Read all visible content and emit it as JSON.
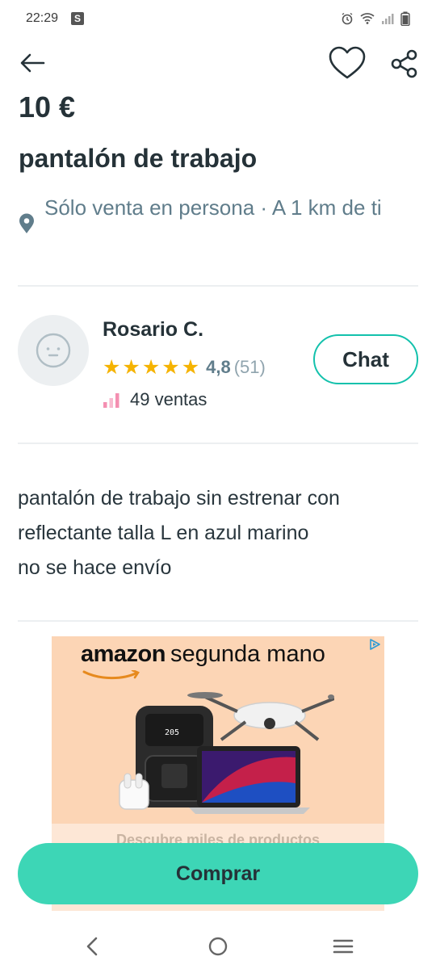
{
  "status_bar": {
    "time": "22:29",
    "badge": "S"
  },
  "listing": {
    "price": "10 €",
    "title": "pantalón de trabajo",
    "location": "Sólo venta en persona · A 1 km de ti"
  },
  "seller": {
    "name": "Rosario C.",
    "rating_value": "4,8",
    "rating_count": "(51)",
    "stars": 5,
    "sales": "49 ventas",
    "chat_label": "Chat"
  },
  "description": {
    "lines": [
      "pantalón de trabajo sin estrenar con",
      "reflectante talla L en azul marino",
      "no se hace envío"
    ]
  },
  "ad": {
    "brand": "amazon",
    "headline": "segunda mano",
    "footer": "Descubre miles de productos"
  },
  "actions": {
    "buy_label": "Comprar"
  },
  "colors": {
    "accent": "#13c1ac",
    "buy_button": "#3dd6b6",
    "star": "#f5b301",
    "text": "#253238",
    "muted": "#607d8b"
  },
  "icons": [
    "back-arrow-icon",
    "heart-icon",
    "share-icon",
    "location-pin-icon",
    "avatar-face-icon",
    "star-icon",
    "sales-bars-icon",
    "ad-choices-icon",
    "nav-back-icon",
    "nav-home-icon",
    "nav-recents-icon"
  ]
}
